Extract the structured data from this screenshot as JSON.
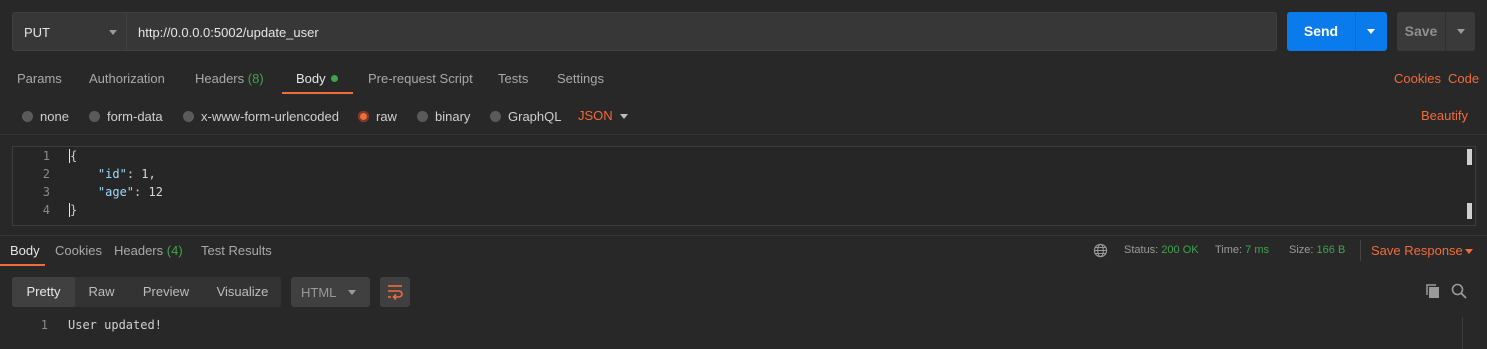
{
  "request": {
    "method": "PUT",
    "url": "http://0.0.0.0:5002/update_user",
    "send_label": "Send",
    "save_label": "Save"
  },
  "request_tabs": [
    {
      "label": "Params"
    },
    {
      "label": "Authorization"
    },
    {
      "label": "Headers",
      "count": "(8)"
    },
    {
      "label": "Body"
    },
    {
      "label": "Pre-request Script"
    },
    {
      "label": "Tests"
    },
    {
      "label": "Settings"
    }
  ],
  "right_links": {
    "cookies": "Cookies",
    "code": "Code"
  },
  "body_types": [
    "none",
    "form-data",
    "x-www-form-urlencoded",
    "raw",
    "binary",
    "GraphQL"
  ],
  "body_type_selected": "raw",
  "body_format": "JSON",
  "beautify_label": "Beautify",
  "editor": {
    "line_numbers": [
      "1",
      "2",
      "3",
      "4"
    ],
    "open_brace": "{",
    "close_brace": "}",
    "id_key": "\"id\"",
    "id_value": "1",
    "age_key": "\"age\"",
    "age_value": "12"
  },
  "response_tabs": [
    {
      "label": "Body"
    },
    {
      "label": "Cookies"
    },
    {
      "label": "Headers",
      "count": "(4)"
    },
    {
      "label": "Test Results"
    }
  ],
  "response_meta": {
    "status_label": "Status:",
    "status_value": "200 OK",
    "time_label": "Time:",
    "time_value": "7 ms",
    "size_label": "Size:",
    "size_value": "166 B",
    "save_response": "Save Response"
  },
  "view_modes": [
    "Pretty",
    "Raw",
    "Preview",
    "Visualize"
  ],
  "view_format": "HTML",
  "response_body": {
    "line_number": "1",
    "text": "User updated!"
  },
  "colors": {
    "accent": "#f26b3a",
    "send_blue": "#097bed",
    "success_green": "#3fa34d",
    "background": "#282828"
  },
  "icons": [
    "chevron-down-icon",
    "globe-icon",
    "wrap-lines-icon",
    "copy-icon",
    "search-icon"
  ]
}
